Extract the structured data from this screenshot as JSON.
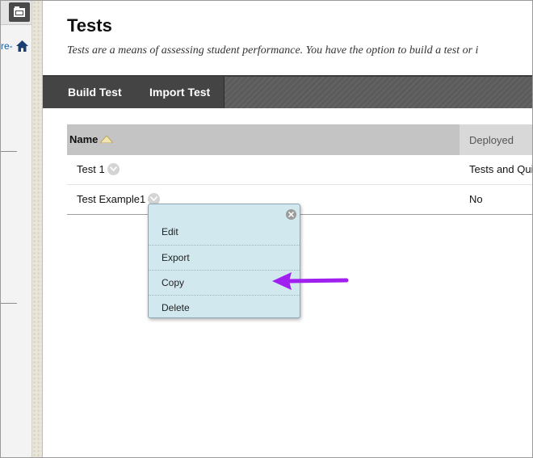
{
  "sidebar": {
    "course_link": "re-",
    "home_icon": "home-icon",
    "toggle_icon": "folder-icon"
  },
  "page": {
    "title": "Tests",
    "description": "Tests are a means of assessing student performance. You have the option to build a test or i"
  },
  "toolbar": {
    "build_test": "Build Test",
    "import_test": "Import Test"
  },
  "table": {
    "columns": {
      "name": "Name",
      "deployed": "Deployed"
    },
    "sort_icon": "sort-ascending-icon",
    "rows": [
      {
        "name": "Test 1",
        "deployed": "Tests and Qui"
      },
      {
        "name": "Test Example1",
        "deployed": "No"
      }
    ]
  },
  "context_menu": {
    "items": [
      "Edit",
      "Export",
      "Copy",
      "Delete"
    ],
    "close_icon": "close-icon"
  },
  "annotation": {
    "arrow_color": "#a020f0",
    "points_to": "Copy"
  },
  "colors": {
    "toolbar": "#444444",
    "menu_bg": "#d1e8ef",
    "link": "#1a5ea8"
  }
}
